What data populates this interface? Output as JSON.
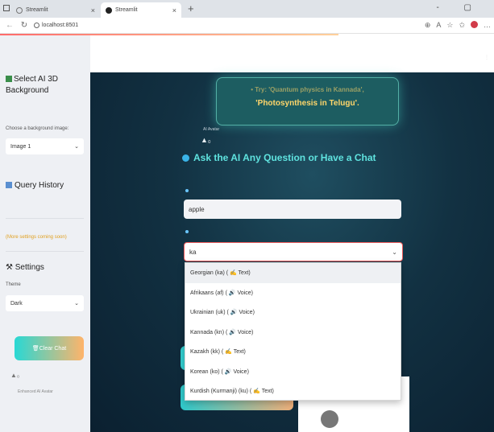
{
  "browser": {
    "tabs": [
      {
        "title": "Streamlit"
      },
      {
        "title": "Streamlit"
      }
    ],
    "new_tab_glyph": "+",
    "url": "localhost:8501",
    "window_controls": "- ▢"
  },
  "sidebar": {
    "background_title": "Select AI 3D Background",
    "background_label": "Choose a background image:",
    "background_value": "Image 1",
    "query_history": "Query History",
    "more_settings": "(More settings coming soon)",
    "settings_title": "Settings",
    "theme_label": "Theme",
    "theme_value": "Dark",
    "clear_chat": "Clear Chat",
    "avatar_caption": "Enhanced AI Avatar"
  },
  "main": {
    "hint_line1": "• Try: 'Quantum physics in Kannada',",
    "hint_line2": "'Photosynthesis in Telugu'.",
    "avatar_caption": "AI Avatar",
    "heading": "Ask the AI Any Question or Have a Chat",
    "question_value": "apple",
    "language_search_value": "ka"
  },
  "dropdown": {
    "options": [
      "Georgian (ka) ( ✍ Text)",
      "Afrikaans (af) ( 🔊 Voice)",
      "Ukrainian (uk) ( 🔊 Voice)",
      "Kannada (kn) ( 🔊 Voice)",
      "Kazakh (kk) ( ✍ Text)",
      "Korean (ko) ( 🔊 Voice)",
      "Kurdish (Kurmanji) (ku) ( ✍ Text)"
    ]
  },
  "colors": {
    "accent_teal": "#5fe3df",
    "hint_yellow": "#ffd66a",
    "error_border": "#ee5c5c"
  }
}
